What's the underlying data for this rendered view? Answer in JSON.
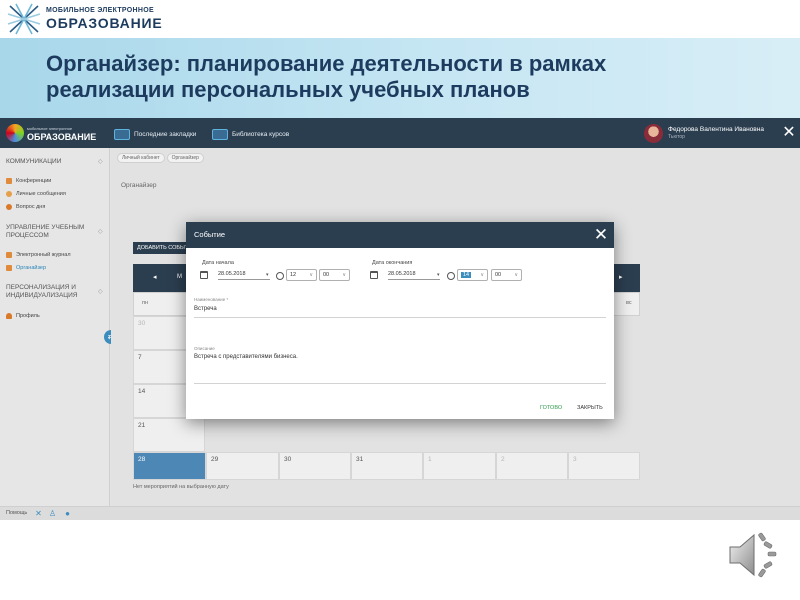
{
  "slide": {
    "logo_line1": "МОБИЛЬНОЕ ЭЛЕКТРОННОЕ",
    "logo_line2": "ОБРАЗОВАНИЕ",
    "title_line1": "Органайзер: планирование деятельности в рамках",
    "title_line2": "реализации персональных учебных планов"
  },
  "app": {
    "logo_small": "мобильное электронное",
    "logo_big": "ОБРАЗОВАНИЕ",
    "topbar": {
      "recent": "Последние закладки",
      "library": "Библиотека курсов"
    },
    "user": {
      "name": "Федорова Валентина Ивановна",
      "role": "Тьютор"
    },
    "sidebar": {
      "section1": "КОММУНИКАЦИИ",
      "items1": [
        "Конференции",
        "Личные сообщения",
        "Вопрос дня"
      ],
      "section2": "УПРАВЛЕНИЕ УЧЕБНЫМ ПРОЦЕССОМ",
      "items2": [
        "Электронный журнал",
        "Органайзер"
      ],
      "section3": "ПЕРСОНАЛИЗАЦИЯ И ИНДИВИДУАЛИЗАЦИЯ",
      "items3": [
        "Профиль"
      ]
    },
    "breadcrumb": [
      "Личный кабинет",
      "Органайзер"
    ],
    "page_title": "Органайзер",
    "add_event": "ДОБАВИТЬ СОБЫТИЕ",
    "calendar": {
      "month_fragment": "М",
      "dow_first": "пн",
      "dow_last": "вс",
      "weeks_first_col": [
        "30",
        "7",
        "14",
        "21",
        "28"
      ],
      "last_row": [
        "28",
        "29",
        "30",
        "31",
        "1",
        "2",
        "3"
      ]
    },
    "no_events": "Нет мероприятий на выбранную дату",
    "footer": "Помощь"
  },
  "modal": {
    "title": "Событие",
    "start_label": "Дата начала",
    "start_date": "28.05.2018",
    "start_hour": "12",
    "start_min": "00",
    "end_label": "Дата окончания",
    "end_date": "28.05.2018",
    "end_hour": "14",
    "end_min": "00",
    "name_label": "Наименование *",
    "name_value": "Встреча",
    "desc_label": "Описание",
    "desc_value": "Встреча с представителями бизнеса.",
    "ok": "ГОТОВО",
    "close": "ЗАКРЫТЬ"
  }
}
